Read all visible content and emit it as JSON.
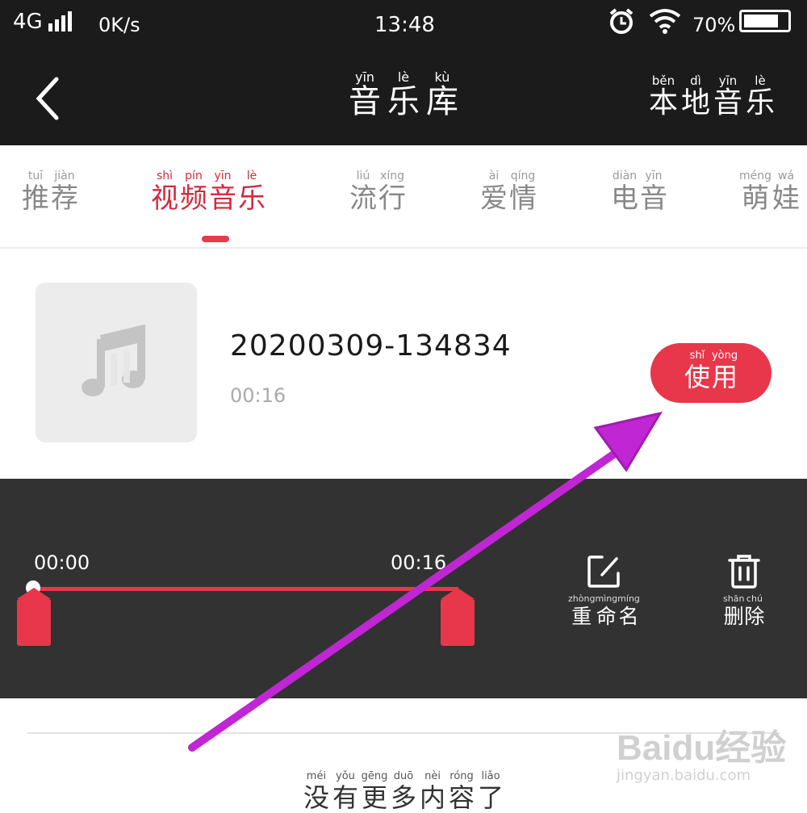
{
  "status_bar": {
    "network": "4G",
    "speed": "0K/s",
    "time": "13:48",
    "battery": "70%"
  },
  "header": {
    "title": [
      {
        "py": "yīn",
        "hz": "音"
      },
      {
        "py": "lè",
        "hz": "乐"
      },
      {
        "py": "kù",
        "hz": "库"
      }
    ],
    "local_music": [
      {
        "py": "běn",
        "hz": "本"
      },
      {
        "py": "dì",
        "hz": "地"
      },
      {
        "py": "yīn",
        "hz": "音"
      },
      {
        "py": "lè",
        "hz": "乐"
      }
    ]
  },
  "tabs": [
    {
      "chars": [
        {
          "py": "tuī",
          "hz": "推"
        },
        {
          "py": "jiàn",
          "hz": "荐"
        }
      ],
      "active": false
    },
    {
      "chars": [
        {
          "py": "shì",
          "hz": "视"
        },
        {
          "py": "pín",
          "hz": "频"
        },
        {
          "py": "yīn",
          "hz": "音"
        },
        {
          "py": "lè",
          "hz": "乐"
        }
      ],
      "active": true
    },
    {
      "chars": [
        {
          "py": "liú",
          "hz": "流"
        },
        {
          "py": "xíng",
          "hz": "行"
        }
      ],
      "active": false
    },
    {
      "chars": [
        {
          "py": "ài",
          "hz": "爱"
        },
        {
          "py": "qíng",
          "hz": "情"
        }
      ],
      "active": false
    },
    {
      "chars": [
        {
          "py": "diàn",
          "hz": "电"
        },
        {
          "py": "yīn",
          "hz": "音"
        }
      ],
      "active": false
    },
    {
      "chars": [
        {
          "py": "méng",
          "hz": "萌"
        },
        {
          "py": "wá",
          "hz": "娃"
        }
      ],
      "active": false
    }
  ],
  "track": {
    "name": "20200309-134834",
    "duration": "00:16",
    "use_button": [
      {
        "py": "shǐ",
        "hz": "使"
      },
      {
        "py": "yòng",
        "hz": "用"
      }
    ]
  },
  "editor": {
    "start_time": "00:00",
    "end_time": "00:16",
    "rename": [
      {
        "py": "zhòng",
        "hz": "重"
      },
      {
        "py": "mìng",
        "hz": "命"
      },
      {
        "py": "míng",
        "hz": "名"
      }
    ],
    "delete": [
      {
        "py": "shān",
        "hz": "删"
      },
      {
        "py": "chú",
        "hz": "除"
      }
    ]
  },
  "footer": [
    {
      "py": "méi",
      "hz": "没"
    },
    {
      "py": "yǒu",
      "hz": "有"
    },
    {
      "py": "gēng",
      "hz": "更"
    },
    {
      "py": "duō",
      "hz": "多"
    },
    {
      "py": "nèi",
      "hz": "内"
    },
    {
      "py": "róng",
      "hz": "容"
    },
    {
      "py": "liǎo",
      "hz": "了"
    }
  ],
  "watermark": {
    "logo": "Baidu经验",
    "url": "jingyan.baidu.com"
  },
  "colors": {
    "accent": "#e8374a",
    "annotation_arrow": "#c026d3",
    "dark_bg": "#1b1b1b",
    "panel_bg": "#323232"
  },
  "icons": [
    "back-chevron-icon",
    "music-note-icon",
    "rename-edit-icon",
    "trash-icon",
    "alarm-icon",
    "wifi-icon",
    "signal-icon",
    "battery-icon"
  ]
}
